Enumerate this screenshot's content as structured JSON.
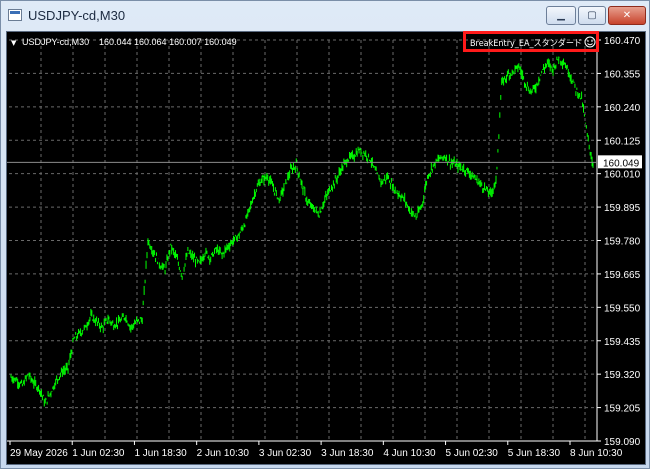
{
  "window": {
    "title": "USDJPY-cd,M30",
    "buttons": {
      "minimize": "▁",
      "maximize": "▢",
      "close": "✕"
    }
  },
  "chart_header": {
    "menu_glyph": "▼",
    "symbol": "USDJPY-cd,M30",
    "ohlc": "160.044 160.064 160.007 160.049"
  },
  "expert_advisor": {
    "name": "BreakEntry_EA_スタンダード",
    "status_icon": "smiley-face-icon"
  },
  "colors": {
    "background": "#000000",
    "candles": "#00ff00",
    "grid": "#6a6a6a",
    "axis_text": "#ffffff",
    "price_line": "#8c8c8c"
  },
  "chart_data": {
    "type": "bar",
    "symbol": "USDJPY-cd",
    "timeframe": "M30",
    "ylim": [
      159.09,
      160.47
    ],
    "y_ticks": [
      160.47,
      160.355,
      160.24,
      160.125,
      160.01,
      159.895,
      159.78,
      159.665,
      159.55,
      159.435,
      159.32,
      159.205,
      159.09
    ],
    "y_tick_labels": [
      "160.470",
      "160.355",
      "160.240",
      "160.125",
      "160.010",
      "159.895",
      "159.780",
      "159.665",
      "159.550",
      "159.435",
      "159.320",
      "159.205",
      "159.090"
    ],
    "x_tick_labels": [
      "29 May 2026",
      "1 Jun 02:30",
      "1 Jun 18:30",
      "2 Jun 10:30",
      "3 Jun 02:30",
      "3 Jun 18:30",
      "4 Jun 10:30",
      "5 Jun 02:30",
      "5 Jun 18:30",
      "8 Jun 10:30"
    ],
    "current_price": 160.049,
    "current_price_label": "160.049",
    "grid": true,
    "series": [
      {
        "values": [
          159.31,
          159.3,
          159.28,
          159.32,
          159.29,
          159.27,
          159.22,
          159.26,
          159.3,
          159.33,
          159.34,
          159.44,
          159.46,
          159.48,
          159.52,
          159.5,
          159.48,
          159.51,
          159.49,
          159.5,
          159.52,
          159.48,
          159.5,
          159.51,
          159.78,
          159.74,
          159.7,
          159.68,
          159.76,
          159.72,
          159.66,
          159.74,
          159.72,
          159.7,
          159.74,
          159.72,
          159.75,
          159.73,
          159.76,
          159.78,
          159.8,
          159.84,
          159.9,
          159.96,
          159.99,
          160.0,
          159.96,
          159.92,
          159.97,
          160.02,
          160.04,
          159.97,
          159.91,
          159.89,
          159.87,
          159.92,
          159.96,
          159.99,
          160.03,
          160.06,
          160.07,
          160.09,
          160.08,
          160.06,
          160.01,
          159.98,
          160.0,
          159.96,
          159.94,
          159.92,
          159.88,
          159.86,
          159.9,
          160.0,
          160.04,
          160.06,
          160.07,
          160.05,
          160.04,
          160.03,
          160.02,
          160.0,
          159.98,
          159.96,
          159.94,
          159.98,
          160.32,
          160.35,
          160.36,
          160.38,
          160.33,
          160.29,
          160.31,
          160.36,
          160.39,
          160.37,
          160.41,
          160.39,
          160.35,
          160.3,
          160.27,
          160.14,
          160.04
        ]
      }
    ]
  }
}
